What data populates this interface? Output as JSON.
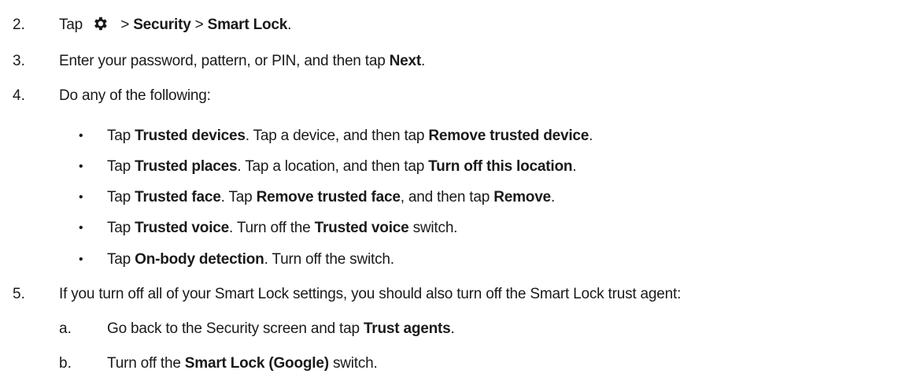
{
  "steps": [
    {
      "num": "2.",
      "parts": [
        {
          "t": "Tap "
        },
        {
          "icon": "gear"
        },
        {
          "t": " > "
        },
        {
          "b": "Security"
        },
        {
          "t": " > "
        },
        {
          "b": "Smart Lock"
        },
        {
          "t": "."
        }
      ]
    },
    {
      "num": "3.",
      "parts": [
        {
          "t": "Enter your password, pattern, or PIN, and then tap "
        },
        {
          "b": "Next"
        },
        {
          "t": "."
        }
      ]
    },
    {
      "num": "4.",
      "parts": [
        {
          "t": "Do any of the following:"
        }
      ]
    },
    {
      "num": "5.",
      "parts": [
        {
          "t": "If you turn off all of your Smart Lock settings, you should also turn off the Smart Lock trust agent:"
        }
      ]
    }
  ],
  "bullets": [
    {
      "bullet": "•",
      "parts": [
        {
          "t": "Tap "
        },
        {
          "b": "Trusted devices"
        },
        {
          "t": ". Tap a device, and then tap "
        },
        {
          "b": "Remove trusted device"
        },
        {
          "t": "."
        }
      ]
    },
    {
      "bullet": "•",
      "parts": [
        {
          "t": "Tap "
        },
        {
          "b": "Trusted places"
        },
        {
          "t": ". Tap a location, and then tap "
        },
        {
          "b": "Turn off this location"
        },
        {
          "t": "."
        }
      ]
    },
    {
      "bullet": "•",
      "parts": [
        {
          "t": "Tap "
        },
        {
          "b": "Trusted face"
        },
        {
          "t": ". Tap "
        },
        {
          "b": "Remove trusted face"
        },
        {
          "t": ", and then tap "
        },
        {
          "b": "Remove"
        },
        {
          "t": "."
        }
      ]
    },
    {
      "bullet": "•",
      "parts": [
        {
          "t": "Tap "
        },
        {
          "b": "Trusted voice"
        },
        {
          "t": ". Turn off the "
        },
        {
          "b": "Trusted voice"
        },
        {
          "t": " switch."
        }
      ]
    },
    {
      "bullet": "•",
      "parts": [
        {
          "t": "Tap "
        },
        {
          "b": "On-body detection"
        },
        {
          "t": ". Turn off the switch."
        }
      ]
    }
  ],
  "substeps": [
    {
      "letter": "a.",
      "parts": [
        {
          "t": "Go back to the Security screen and tap "
        },
        {
          "b": "Trust agents"
        },
        {
          "t": "."
        }
      ]
    },
    {
      "letter": "b.",
      "parts": [
        {
          "t": "Turn off the "
        },
        {
          "b": "Smart Lock (Google)"
        },
        {
          "t": " switch."
        }
      ]
    }
  ],
  "icon_name": "gear-icon"
}
